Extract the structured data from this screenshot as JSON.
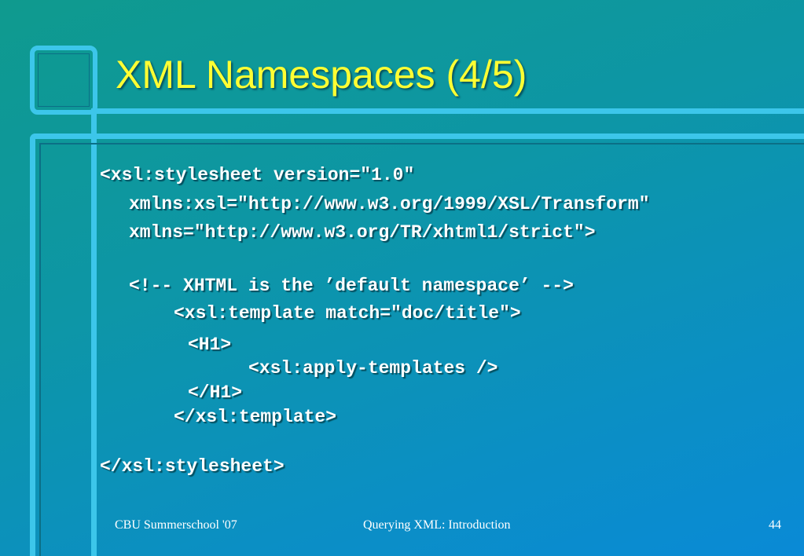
{
  "slide": {
    "title": "XML Namespaces (4/5)",
    "code_lines": [
      "<xsl:stylesheet version=\"1.0\"",
      "xmlns:xsl=\"http://www.w3.org/1999/XSL/Transform\"",
      "xmlns=\"http://www.w3.org/TR/xhtml1/strict\">",
      "<!-- XHTML is the ’default namespace’ -->",
      "<xsl:template match=\"doc/title\">",
      "<H1>",
      "<xsl:apply-templates />",
      "</H1>",
      "</xsl:template>",
      "</xsl:stylesheet>"
    ],
    "footer": {
      "left": "CBU Summerschool '07",
      "center": "Querying XML: Introduction",
      "page_number": "44"
    }
  },
  "colors": {
    "title": "#ffff33",
    "frame": "#3cc6ea",
    "background_start": "#0f9a8e",
    "background_end": "#0a8ad6"
  }
}
